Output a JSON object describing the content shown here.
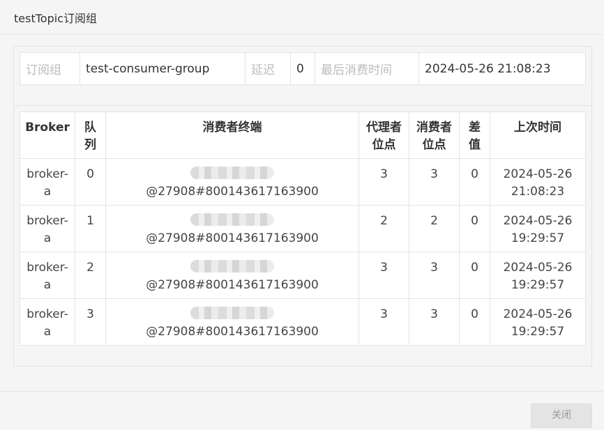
{
  "modal": {
    "title": "testTopic订阅组",
    "close_label": "关闭"
  },
  "info": {
    "group_label": "订阅组",
    "group_value": "test-consumer-group",
    "delay_label": "延迟",
    "delay_value": "0",
    "last_consume_label": "最后消费时间",
    "last_consume_value": "2024-05-26 21:08:23"
  },
  "table": {
    "headers": {
      "broker": "Broker",
      "queue": "队\n列",
      "client": "消费者终端",
      "broker_offset": "代理者\n位点",
      "consumer_offset": "消费者\n位点",
      "diff": "差\n值",
      "last_time": "上次时间"
    },
    "rows": [
      {
        "broker": "broker-\na",
        "queue": "0",
        "client": "@27908#800143617163900",
        "broker_offset": "3",
        "consumer_offset": "3",
        "diff": "0",
        "last_time": "2024-05-26\n21:08:23"
      },
      {
        "broker": "broker-\na",
        "queue": "1",
        "client": "@27908#800143617163900",
        "broker_offset": "2",
        "consumer_offset": "2",
        "diff": "0",
        "last_time": "2024-05-26\n19:29:57"
      },
      {
        "broker": "broker-\na",
        "queue": "2",
        "client": "@27908#800143617163900",
        "broker_offset": "3",
        "consumer_offset": "3",
        "diff": "0",
        "last_time": "2024-05-26\n19:29:57"
      },
      {
        "broker": "broker-\na",
        "queue": "3",
        "client": "@27908#800143617163900",
        "broker_offset": "3",
        "consumer_offset": "3",
        "diff": "0",
        "last_time": "2024-05-26\n19:29:57"
      }
    ]
  }
}
